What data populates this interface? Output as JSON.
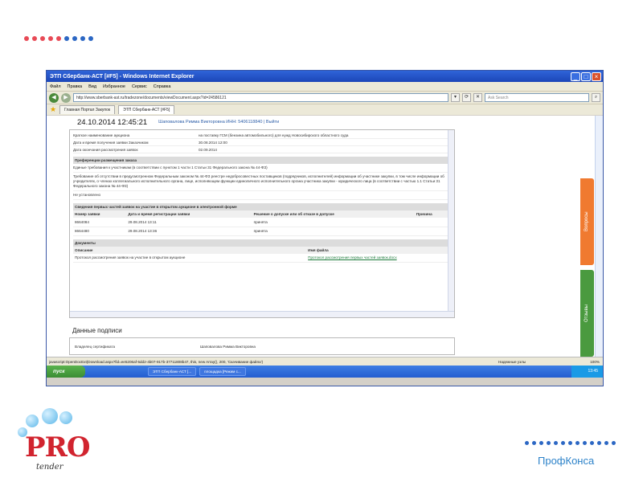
{
  "window": {
    "title": "ЭТП Сбербанк-АСТ [#F5] - Windows Internet Explorer",
    "menu": [
      "Файл",
      "Правка",
      "Вид",
      "Избранное",
      "Сервис",
      "Справка"
    ],
    "url": "http://www.sberbank-ast.ru/tradezone/documents/viewDocument.aspx?id=24586121",
    "search_placeholder": "Ask Search",
    "tabs": [
      "Главная Портал Закупок",
      "ЭТП Сбербанк-АСТ [#F5]"
    ]
  },
  "page": {
    "date": "24.10.2014 12:45:21",
    "user": "Шаповалова Римма Викторовна ИНН: 5406118840 | Выйти",
    "fields": [
      {
        "key": "Краткое наименование аукциона",
        "value": "на поставку ГСМ (бензина автомобильного) для нужд Новосибирского областного суда"
      },
      {
        "key": "Дата и время получения заявки Заказчиком",
        "value": "30.08.2014 12:00"
      },
      {
        "key": "Дата окончания рассмотрения заявок",
        "value": "02.09.2014"
      }
    ],
    "preferences": {
      "heading": "Преференции размещения заказа",
      "lines": [
        "Единые требования к участникам (в соответствии с пунктом 1 части 1 Статьи 31 Федерального закона № 44-ФЗ)",
        "Требование об отсутствии в предусмотренном Федеральным законом № 44-ФЗ реестре недобросовестных поставщиков (подрядчиков, исполнителей) информации об участнике закупки, в том числе информации об учредителях, о членах коллегиального исполнительного органа, лице, исполняющем функции единоличного исполнительного органа участника закупки - юридического лица (в соответствии с частью 1.1 Статьи 31 Федерального закона № 44-ФЗ)",
        "Не установлено"
      ]
    },
    "applications": {
      "heading": "Сведения первых частей заявок на участие в открытом аукционе в электронной форме",
      "columns": [
        "Номер заявки",
        "Дата и время регистрации заявки",
        "Решение о допуске или об отказе в допуске",
        "Причина"
      ],
      "rows": [
        [
          "8664084",
          "29.08.2014 13:11",
          "принята",
          ""
        ],
        [
          "8664480",
          "29.08.2014 13:36",
          "принята",
          ""
        ]
      ]
    },
    "documents": {
      "heading": "Документы",
      "columns": [
        "Описание",
        "Имя файла"
      ],
      "rows": [
        [
          "Протокол рассмотрения заявок на участие в открытом аукционе",
          "Протокол рассмотрения первых частей заявок.docx"
        ]
      ]
    },
    "signature": {
      "title": "Данные подписи",
      "key": "Владелец сертификата",
      "value": "Шаповалова Римма Викторовна"
    },
    "side_tabs": [
      "Вопросы",
      "Отзывы"
    ]
  },
  "status_bar": {
    "text": "javascript:OpenDocExt(Download.aspx?fid=ee5206af-5dd2-4b07-917b-37711808b47, this, new Array(), 200, 'Скачивание файла')",
    "zone": "Надежные узлы",
    "zoom": "100%"
  },
  "taskbar": {
    "start": "пуск",
    "items": [
      "ЭТП Сбербанк-АСТ [...",
      "площадка [Режим с..."
    ],
    "clock": "13:45"
  },
  "branding": {
    "logo_pro": "PRO",
    "logo_tender": "tender",
    "company": "ПрофКонса"
  }
}
